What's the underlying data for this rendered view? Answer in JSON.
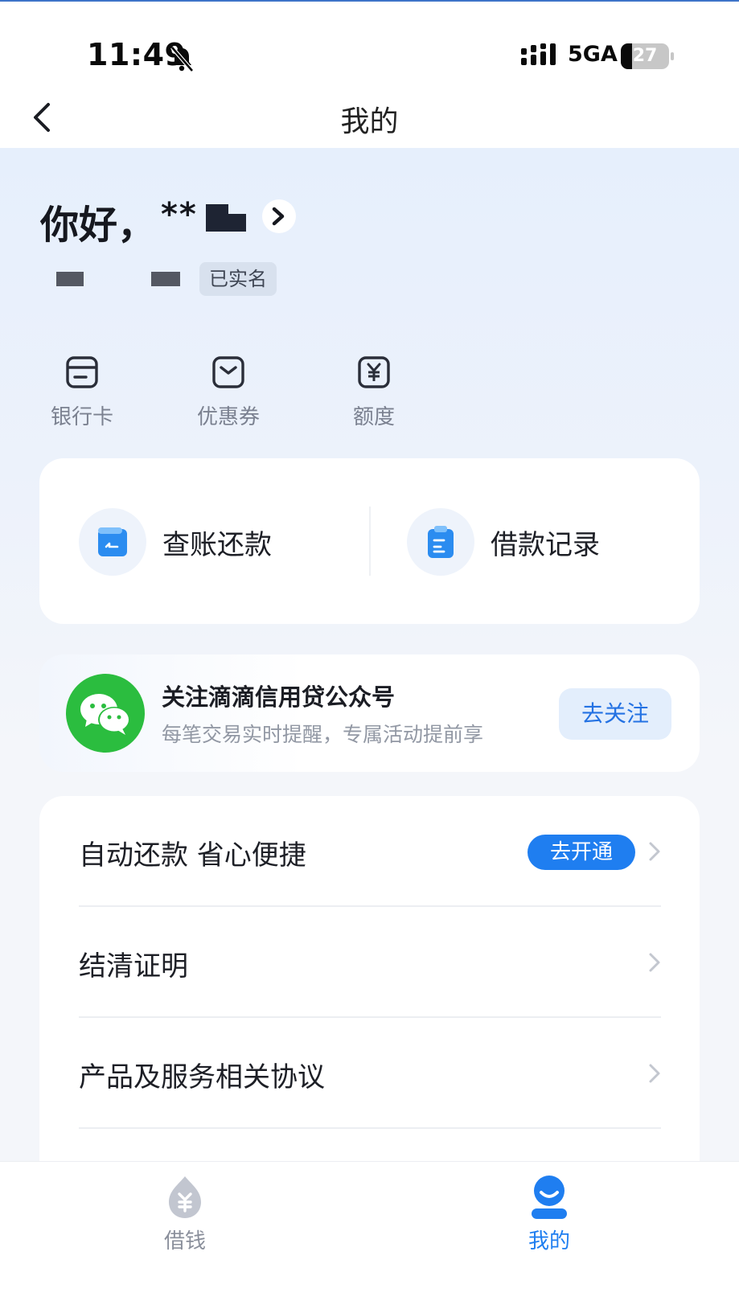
{
  "status_bar": {
    "time": "11:49",
    "network": "5GA",
    "battery": "27"
  },
  "nav": {
    "title": "我的"
  },
  "profile": {
    "greeting": "你好，",
    "name_masked": "**",
    "verified_badge": "已实名"
  },
  "quick_links": [
    {
      "label": "银行卡",
      "icon": "bank-card-icon"
    },
    {
      "label": "优惠券",
      "icon": "coupon-icon"
    },
    {
      "label": "额度",
      "icon": "credit-limit-icon"
    }
  ],
  "features": {
    "repay": {
      "label": "查账还款",
      "icon": "wallet-icon"
    },
    "records": {
      "label": "借款记录",
      "icon": "document-icon"
    }
  },
  "wechat_promo": {
    "title": "关注滴滴信用贷公众号",
    "subtitle": "每笔交易实时提醒，专属活动提前享",
    "button": "去关注"
  },
  "menu": {
    "auto_repay": {
      "label": "自动还款 省心便捷",
      "button": "去开通"
    },
    "settlement": {
      "label": "结清证明"
    },
    "agreements": {
      "label": "产品及服务相关协议"
    }
  },
  "tabbar": {
    "borrow": "借钱",
    "mine": "我的"
  },
  "colors": {
    "accent": "#1f7ef0",
    "wechat_green": "#2bbd3f",
    "tab_inactive": "#b8bdc8"
  }
}
